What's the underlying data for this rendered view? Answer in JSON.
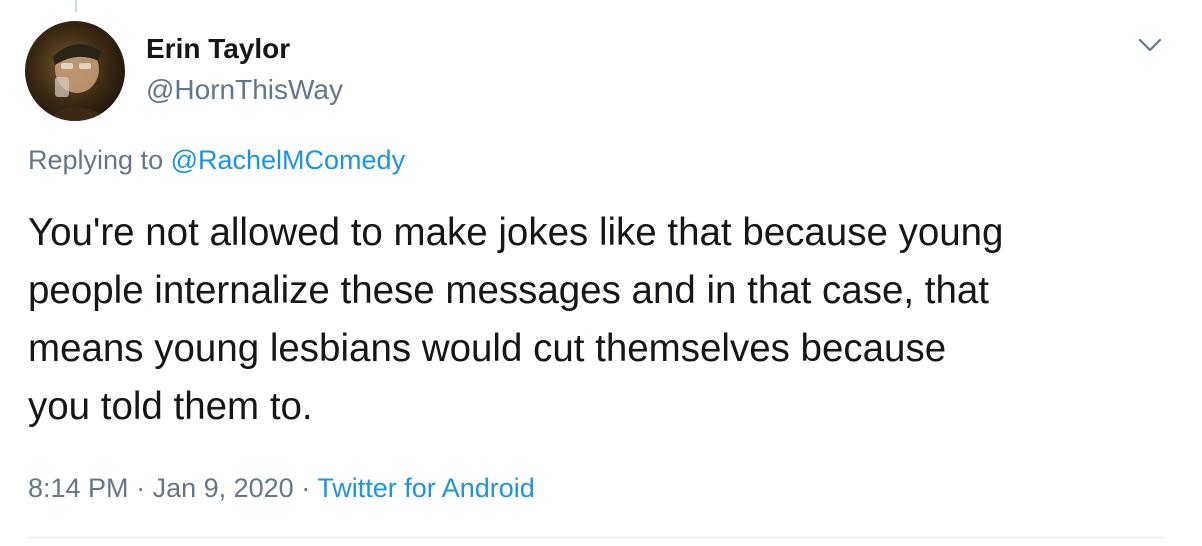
{
  "author": {
    "name": "Erin Taylor",
    "handle": "@HornThisWay"
  },
  "reply": {
    "prefix": "Replying to ",
    "mention": "@RachelMComedy"
  },
  "tweet": {
    "lines": [
      "You're not allowed to make jokes like that because young",
      "people internalize these messages and in that case, that",
      "means young lesbians would cut themselves because",
      "you told them to."
    ]
  },
  "meta": {
    "time": "8:14 PM",
    "separator": " · ",
    "date": "Jan 9, 2020",
    "source": "Twitter for Android"
  },
  "icons": {
    "menu": "chevron-down-icon"
  },
  "colors": {
    "text": "#14171a",
    "secondary": "#657786",
    "link": "#1b95e0",
    "divider": "#e6ecf0"
  }
}
